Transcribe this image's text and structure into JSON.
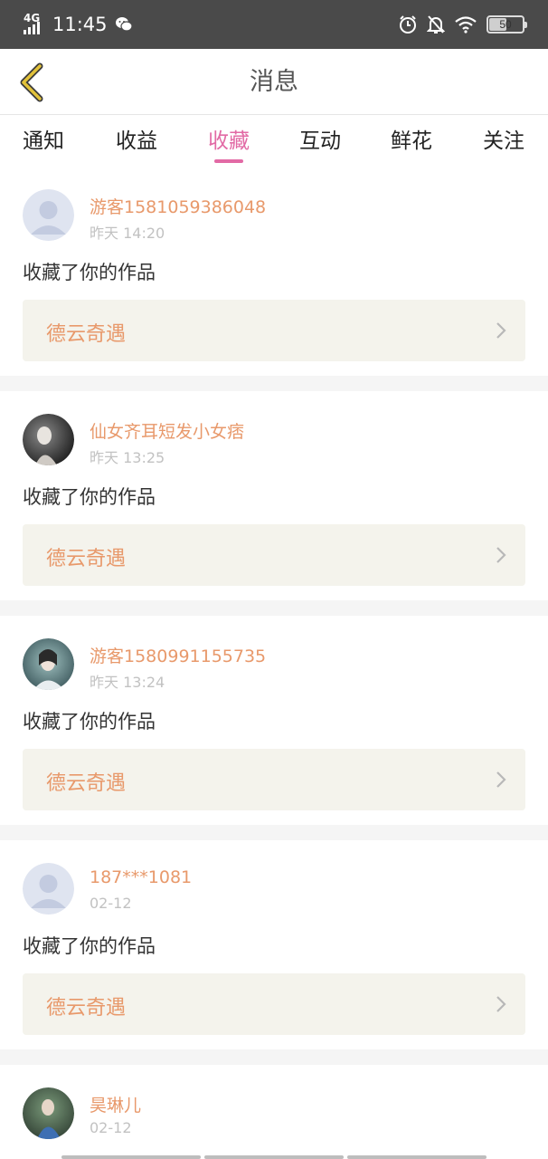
{
  "status_bar": {
    "network": "4G",
    "time": "11:45",
    "battery": "50",
    "battery_level": 0.5
  },
  "header": {
    "title": "消息"
  },
  "tabs": [
    {
      "label": "通知"
    },
    {
      "label": "收益"
    },
    {
      "label": "收藏"
    },
    {
      "label": "互动"
    },
    {
      "label": "鲜花"
    },
    {
      "label": "关注"
    }
  ],
  "active_tab": "收藏",
  "messages": [
    {
      "username": "游客1581059386048",
      "time": "昨天 14:20",
      "action": "收藏了你的作品",
      "work": "德云奇遇",
      "avatar": "default-avatar"
    },
    {
      "username": "仙女齐耳短发小女痞",
      "time": "昨天 13:25",
      "action": "收藏了你的作品",
      "work": "德云奇遇",
      "avatar": "photo-avatar"
    },
    {
      "username": "游客1580991155735",
      "time": "昨天 13:24",
      "action": "收藏了你的作品",
      "work": "德云奇遇",
      "avatar": "photo-avatar"
    },
    {
      "username": "187***1081",
      "time": "02-12",
      "action": "收藏了你的作品",
      "work": "德云奇遇",
      "avatar": "default-avatar"
    },
    {
      "username": "昊琳儿",
      "time": "02-12",
      "avatar": "photo-avatar"
    }
  ],
  "colors": {
    "accent": "#e26aa5",
    "username": "#e8996b",
    "card_bg": "#f4f3ec",
    "status_bar": "#4a4a4a",
    "back_arrow": "#e2c23a"
  }
}
